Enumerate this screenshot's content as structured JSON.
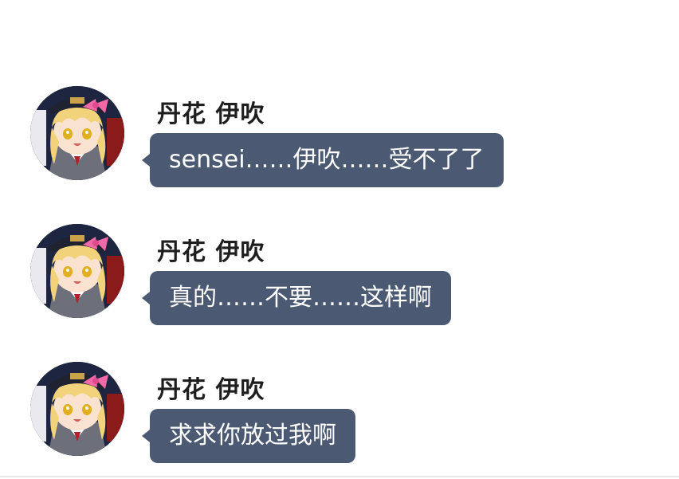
{
  "messages": [
    {
      "sender": "丹花 伊吹",
      "text": "sensei……伊吹……受不了了"
    },
    {
      "sender": "丹花 伊吹",
      "text": "真的……不要……这样啊"
    },
    {
      "sender": "丹花 伊吹",
      "text": "求求你放过我啊"
    }
  ],
  "colors": {
    "bubble": "#4b5a72",
    "bubble_text": "#ffffff",
    "name_text": "#1e1e1e",
    "background": "#ffffff"
  },
  "icons": {
    "avatar": "avatar-icon"
  }
}
